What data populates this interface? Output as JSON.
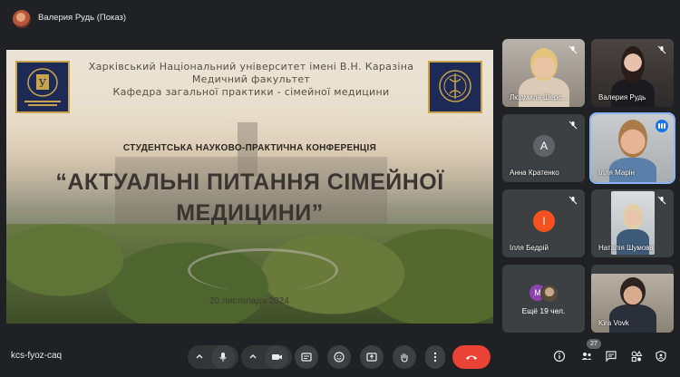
{
  "window": {
    "presenter_title": "Валерия Рудь (Показ)"
  },
  "slide": {
    "university_line1": "Харківський Національний університет імені В.Н. Каразіна",
    "university_line2": "Медичний факультет",
    "university_line3": "Кафедра загальної практики - сімейної медицини",
    "conference_subtitle": "СТУДЕНТСЬКА НАУКОВО-ПРАКТИЧНА КОНФЕРЕНЦІЯ",
    "conference_title_line1": "“АКТУАЛЬНІ ПИТАННЯ СІМЕЙНОЇ",
    "conference_title_line2": "МЕДИЦИНИ”",
    "date": "20 листопада 2024",
    "emblem_colors": {
      "navy": "#1d2a55",
      "gold": "#c9a44c"
    }
  },
  "participants": [
    {
      "name": "Людмила Шерс...",
      "muted": true,
      "video": true
    },
    {
      "name": "Валерия Рудь",
      "muted": true,
      "video": true
    },
    {
      "name": "Анна Кратенко",
      "muted": true,
      "video": false,
      "initial": "А",
      "avatar_color": "#5f6368"
    },
    {
      "name": "Ілля Марін",
      "muted": false,
      "speaking": true,
      "video": true
    },
    {
      "name": "Ілля Бедрій",
      "muted": true,
      "video": false,
      "initial": "І",
      "avatar_color": "#f4511e"
    },
    {
      "name": "Наталія Шумова",
      "muted": true,
      "video": true
    },
    {
      "name": "Ещё 19 чел.",
      "video": false,
      "initial": "М",
      "avatar_color": "#8e44ad"
    },
    {
      "name": "Kira Vovk",
      "muted": false,
      "video": true
    }
  ],
  "bottom_bar": {
    "meeting_code": "kcs-fyoz-caq",
    "participant_count": "27",
    "controls": [
      "microphone-icon",
      "camera-icon",
      "captions-icon",
      "emoji-icon",
      "present-icon",
      "raise-hand-icon",
      "more-options-icon",
      "end-call-icon"
    ],
    "right_controls": [
      "info-icon",
      "people-icon",
      "chat-icon",
      "activities-icon",
      "host-controls-icon"
    ],
    "end_call_color": "#ea4335",
    "accent_color": "#8ab4f8"
  }
}
